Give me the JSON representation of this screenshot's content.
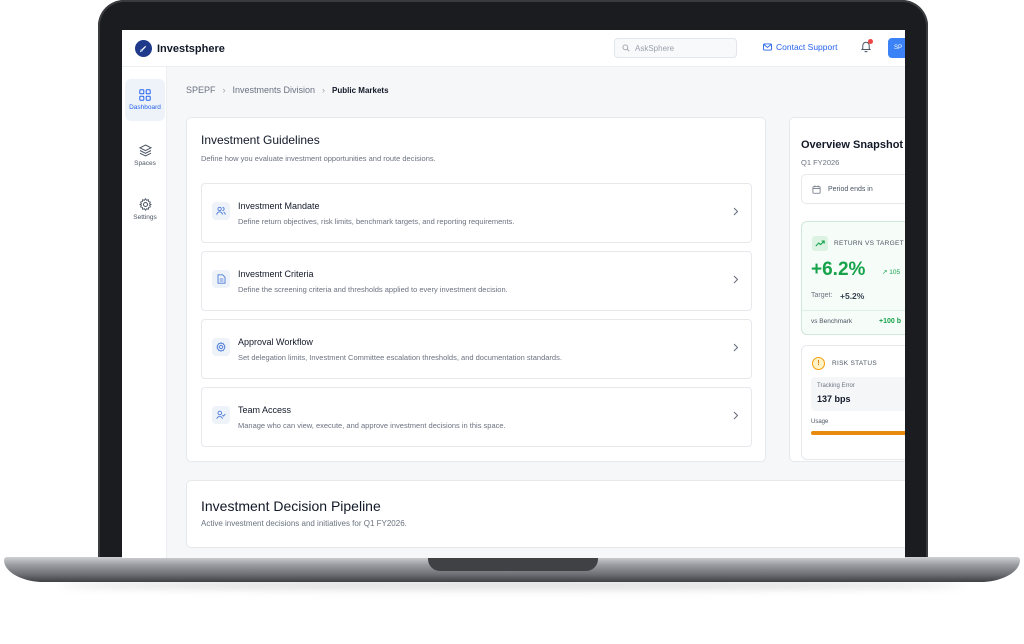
{
  "app": {
    "brand": "Investsphere",
    "search_placeholder": "AskSphere",
    "contact_support": "Contact Support",
    "avatar_initials": "SP"
  },
  "sidebar": {
    "items": [
      {
        "label": "Dashboard",
        "icon": "grid-icon",
        "active": true
      },
      {
        "label": "Spaces",
        "icon": "layers-icon",
        "active": false
      },
      {
        "label": "Settings",
        "icon": "gear-icon",
        "active": false
      }
    ]
  },
  "breadcrumb": [
    "SPEPF",
    "Investments Division",
    "Public Markets"
  ],
  "guidelines": {
    "title": "Investment Guidelines",
    "subtitle": "Define how you evaluate investment opportunities and route decisions.",
    "items": [
      {
        "title": "Investment Mandate",
        "desc": "Define return objectives, risk limits, benchmark targets, and reporting requirements.",
        "icon": "users-icon"
      },
      {
        "title": "Investment Criteria",
        "desc": "Define the screening criteria and thresholds applied to every investment decision.",
        "icon": "document-icon"
      },
      {
        "title": "Approval Workflow",
        "desc": "Set delegation limits, Investment Committee escalation thresholds, and documentation standards.",
        "icon": "gear-icon"
      },
      {
        "title": "Team Access",
        "desc": "Manage who can view, execute, and approve investment decisions in this space.",
        "icon": "user-check-icon"
      }
    ]
  },
  "overview": {
    "title": "Overview Snapshot",
    "period": "Q1 FY2026",
    "period_ends_label": "Period ends in",
    "return_label": "RETURN VS TARGET",
    "return_value": "+6.2%",
    "return_delta": "↗ 105",
    "target_label": "Target:",
    "target_value": "+5.2%",
    "benchmark_label": "vs Benchmark",
    "benchmark_value": "+100 b",
    "risk_label": "RISK STATUS",
    "tracking_error_label": "Tracking Error",
    "tracking_error_value": "137 bps",
    "usage_label": "Usage",
    "usage_fraction": 0.85
  },
  "pipeline": {
    "title": "Investment Decision Pipeline",
    "subtitle": "Active investment decisions and initiatives for Q1 FY2026."
  },
  "colors": {
    "accent": "#2563eb",
    "positive": "#16a34a",
    "warning": "#e88a0c"
  }
}
